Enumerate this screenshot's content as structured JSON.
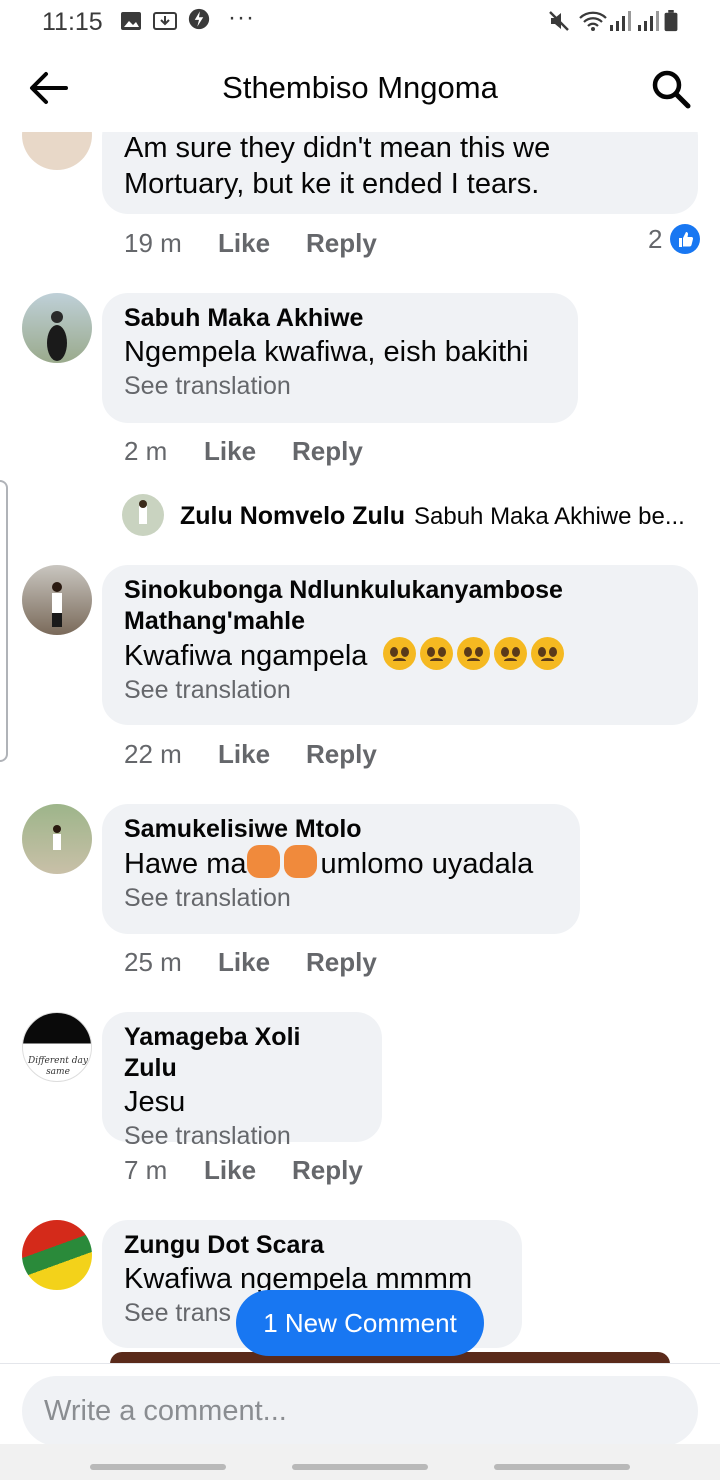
{
  "status_bar": {
    "time": "11:15",
    "dots": "···"
  },
  "header": {
    "title": "Sthembiso Mngoma"
  },
  "comments": [
    {
      "text_line1": "Am sure they didn't mean this we",
      "text_line2": "Mortuary, but ke it ended I tears.",
      "time": "19 m",
      "like": "Like",
      "reply": "Reply",
      "like_count": "2"
    },
    {
      "author": "Sabuh Maka Akhiwe",
      "text": "Ngempela kwafiwa, eish bakithi",
      "translate": "See translation",
      "time": "2 m",
      "like": "Like",
      "reply": "Reply"
    },
    {
      "author_line1": "Sinokubonga Ndlunkulukanyambose",
      "author_line2": "Mathang'mahle",
      "text": "Kwafiwa ngampela",
      "translate": "See translation",
      "time": "22 m",
      "like": "Like",
      "reply": "Reply"
    },
    {
      "author": "Samukelisiwe Mtolo",
      "text_before": "Hawe ma",
      "text_after": "umlomo uyadala",
      "translate": "See translation",
      "time": "25 m",
      "like": "Like",
      "reply": "Reply"
    },
    {
      "author": "Yamageba Xoli Zulu",
      "text": "Jesu",
      "translate": "See translation",
      "time": "7 m",
      "like": "Like",
      "reply": "Reply",
      "avatar_text_1": "Different day",
      "avatar_text_2": "same"
    },
    {
      "author": "Zungu Dot Scara",
      "text": "Kwafiwa ngempela mmmm",
      "translate": "See trans"
    }
  ],
  "reply_preview": {
    "name": "Zulu Nomvelo Zulu",
    "text": "Sabuh Maka Akhiwe be..."
  },
  "new_comment_pill": "1 New Comment",
  "composer": {
    "placeholder": "Write a comment..."
  },
  "colors": {
    "accent": "#1877f2",
    "bubble": "#f0f2f5",
    "meta": "#65676b"
  }
}
